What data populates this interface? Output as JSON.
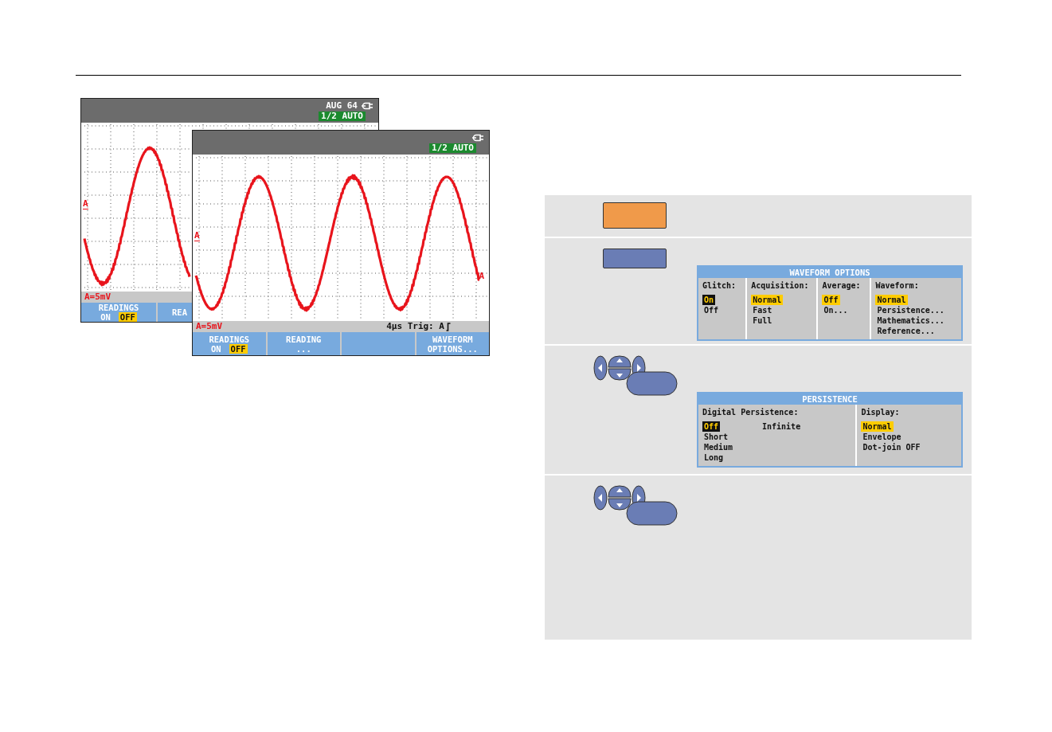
{
  "scopes": [
    {
      "header_text": "AUG 64",
      "badge": "1/2 AUTO",
      "marker": "A",
      "readout": "A=5mV",
      "softkeys": [
        {
          "kind": "toggle",
          "label": "READINGS",
          "options": [
            {
              "text": "ON",
              "selected": false
            },
            {
              "text": "OFF",
              "selected": true
            }
          ]
        },
        {
          "kind": "label",
          "label": "REA"
        }
      ]
    },
    {
      "badge": "1/2 AUTO",
      "marker": "A",
      "end_marker": "A",
      "readout": "A=5mV",
      "trigger": "4µs Trig: A",
      "softkeys": [
        {
          "kind": "toggle",
          "label": "READINGS",
          "options": [
            {
              "text": "ON",
              "selected": false
            },
            {
              "text": "OFF",
              "selected": true
            }
          ]
        },
        {
          "kind": "label",
          "label": "READING",
          "sub": "..."
        },
        {
          "kind": "blank"
        },
        {
          "kind": "label",
          "label": "WAVEFORM",
          "sub": "OPTIONS..."
        }
      ]
    }
  ],
  "steps": [
    {
      "kind": "function-key"
    },
    {
      "kind": "softkey",
      "menu": {
        "title": "WAVEFORM OPTIONS",
        "columns": [
          {
            "heading": "Glitch:",
            "options": [
              {
                "text": "On",
                "selected": true,
                "focused": true
              },
              {
                "text": "Off",
                "selected": false,
                "focused": false
              }
            ]
          },
          {
            "heading": "Acquisition:",
            "options": [
              {
                "text": "Normal",
                "selected": true,
                "focused": false
              },
              {
                "text": "Fast",
                "selected": false,
                "focused": false
              },
              {
                "text": "Full",
                "selected": false,
                "focused": false
              }
            ]
          },
          {
            "heading": "Average:",
            "options": [
              {
                "text": "Off",
                "selected": true,
                "focused": false
              },
              {
                "text": "On...",
                "selected": false,
                "focused": false
              }
            ]
          },
          {
            "heading": "Waveform:",
            "options": [
              {
                "text": "Normal",
                "selected": true,
                "focused": false
              },
              {
                "text": "Persistence...",
                "selected": false,
                "focused": false
              },
              {
                "text": "Mathematics...",
                "selected": false,
                "focused": false
              },
              {
                "text": "Reference...",
                "selected": false,
                "focused": false
              }
            ]
          }
        ]
      }
    },
    {
      "kind": "arrow-pad",
      "menu": {
        "title": "PERSISTENCE",
        "columns": [
          {
            "heading": "Digital Persistence:",
            "options": [
              {
                "text": "Off",
                "selected": true,
                "focused": true
              },
              {
                "text": "Short",
                "selected": false,
                "focused": false
              },
              {
                "text": "Medium",
                "selected": false,
                "focused": false
              },
              {
                "text": "Long",
                "selected": false,
                "focused": false
              },
              {
                "text": "Infinite",
                "selected": false,
                "focused": false
              }
            ]
          },
          {
            "heading": "Display:",
            "options": [
              {
                "text": "Normal",
                "selected": true,
                "focused": false
              },
              {
                "text": "Envelope",
                "selected": false,
                "focused": false
              },
              {
                "text": "Dot-join OFF",
                "selected": false,
                "focused": false
              }
            ]
          }
        ]
      }
    },
    {
      "kind": "arrow-pad"
    }
  ]
}
